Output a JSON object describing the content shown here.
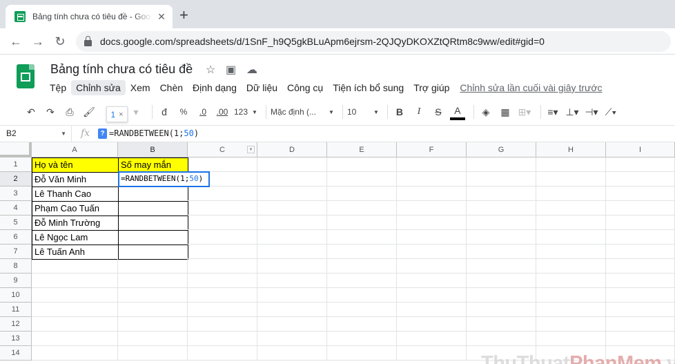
{
  "browser": {
    "tab_title": "Bảng tính chưa có tiêu đề - Google Trang tính",
    "url": "docs.google.com/spreadsheets/d/1SnF_h9Q5gkBLuApm6ejrsm-2QJQyDKOXZtQRtm8c9ww/edit#gid=0"
  },
  "doc": {
    "title": "Bảng tính chưa có tiêu đề",
    "last_edit": "Chỉnh sửa lần cuối vài giây trước"
  },
  "menu": [
    "Tệp",
    "Chỉnh sửa",
    "Xem",
    "Chèn",
    "Định dạng",
    "Dữ liệu",
    "Công cụ",
    "Tiện ích bổ sung",
    "Trợ giúp"
  ],
  "toolbar": {
    "format_currency": "đ",
    "format_percent": "%",
    "decimal_decrease": ".0",
    "decimal_increase": ".00",
    "more_formats": "123",
    "font": "Mặc định (...",
    "font_size": "10",
    "bold": "B",
    "italic": "I",
    "strike": "S",
    "text_color": "A",
    "tooltip_value": "1",
    "tooltip_close": "×"
  },
  "formula_bar": {
    "cell_ref": "B2",
    "fx": "fx",
    "help": "?",
    "formula_prefix": "=RANDBETWEEN(1;",
    "formula_highlight": "50",
    "formula_suffix": ")"
  },
  "grid": {
    "columns": [
      "A",
      "B",
      "C",
      "D",
      "E",
      "F",
      "G",
      "H",
      "I"
    ],
    "rows": [
      "1",
      "2",
      "3",
      "4",
      "5",
      "6",
      "7",
      "8",
      "9",
      "10",
      "11",
      "12",
      "13",
      "14"
    ],
    "header_a": "Họ và tên",
    "header_b": "Số may mắn",
    "names": [
      "Đỗ Văn Minh",
      "Lê Thanh Cao",
      "Phạm Cao Tuấn",
      "Đỗ Minh Trường",
      "Lê Ngọc Lam",
      "Lê Tuấn Anh"
    ],
    "active_prefix": "=RANDBETWEEN(1;",
    "active_highlight": "50",
    "active_suffix": ")"
  },
  "watermark": {
    "part1": "ThuThuat",
    "part2": "PhanMem",
    "part3": ".vn"
  },
  "colors": {
    "accent": "#1a73e8",
    "header_fill": "#ffff00",
    "sheets_green": "#0f9d58"
  }
}
